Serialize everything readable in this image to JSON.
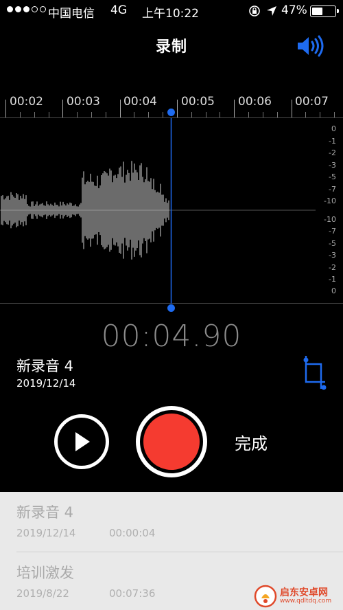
{
  "status_bar": {
    "carrier": "中国电信",
    "network": "4G",
    "time": "上午10:22",
    "battery_percent": "47%",
    "battery_level": 0.47,
    "signal_bars": 3
  },
  "nav": {
    "title": "录制"
  },
  "ruler": {
    "labels": [
      "00:02",
      "00:03",
      "00:04",
      "00:05",
      "00:06",
      "00:07"
    ]
  },
  "db_scale": {
    "top": [
      "0",
      "-1",
      "-2",
      "-3",
      "-5",
      "-7",
      "-10"
    ],
    "bottom": [
      "-10",
      "-7",
      "-5",
      "-3",
      "-2",
      "-1",
      "0"
    ]
  },
  "elapsed_time": "00:04.90",
  "recording": {
    "name": "新录音 4",
    "date": "2019/12/14"
  },
  "controls": {
    "done_label": "完成"
  },
  "list": [
    {
      "name": "新录音 4",
      "date": "2019/12/14",
      "duration": "00:00:04"
    },
    {
      "name": "培训激发",
      "date": "2019/8/22",
      "duration": "00:07:36"
    }
  ],
  "watermark": {
    "text": "启东安卓网",
    "url": "www.qdltdq.com"
  },
  "colors": {
    "accent": "#1e6bf0",
    "record": "#f53b30"
  }
}
